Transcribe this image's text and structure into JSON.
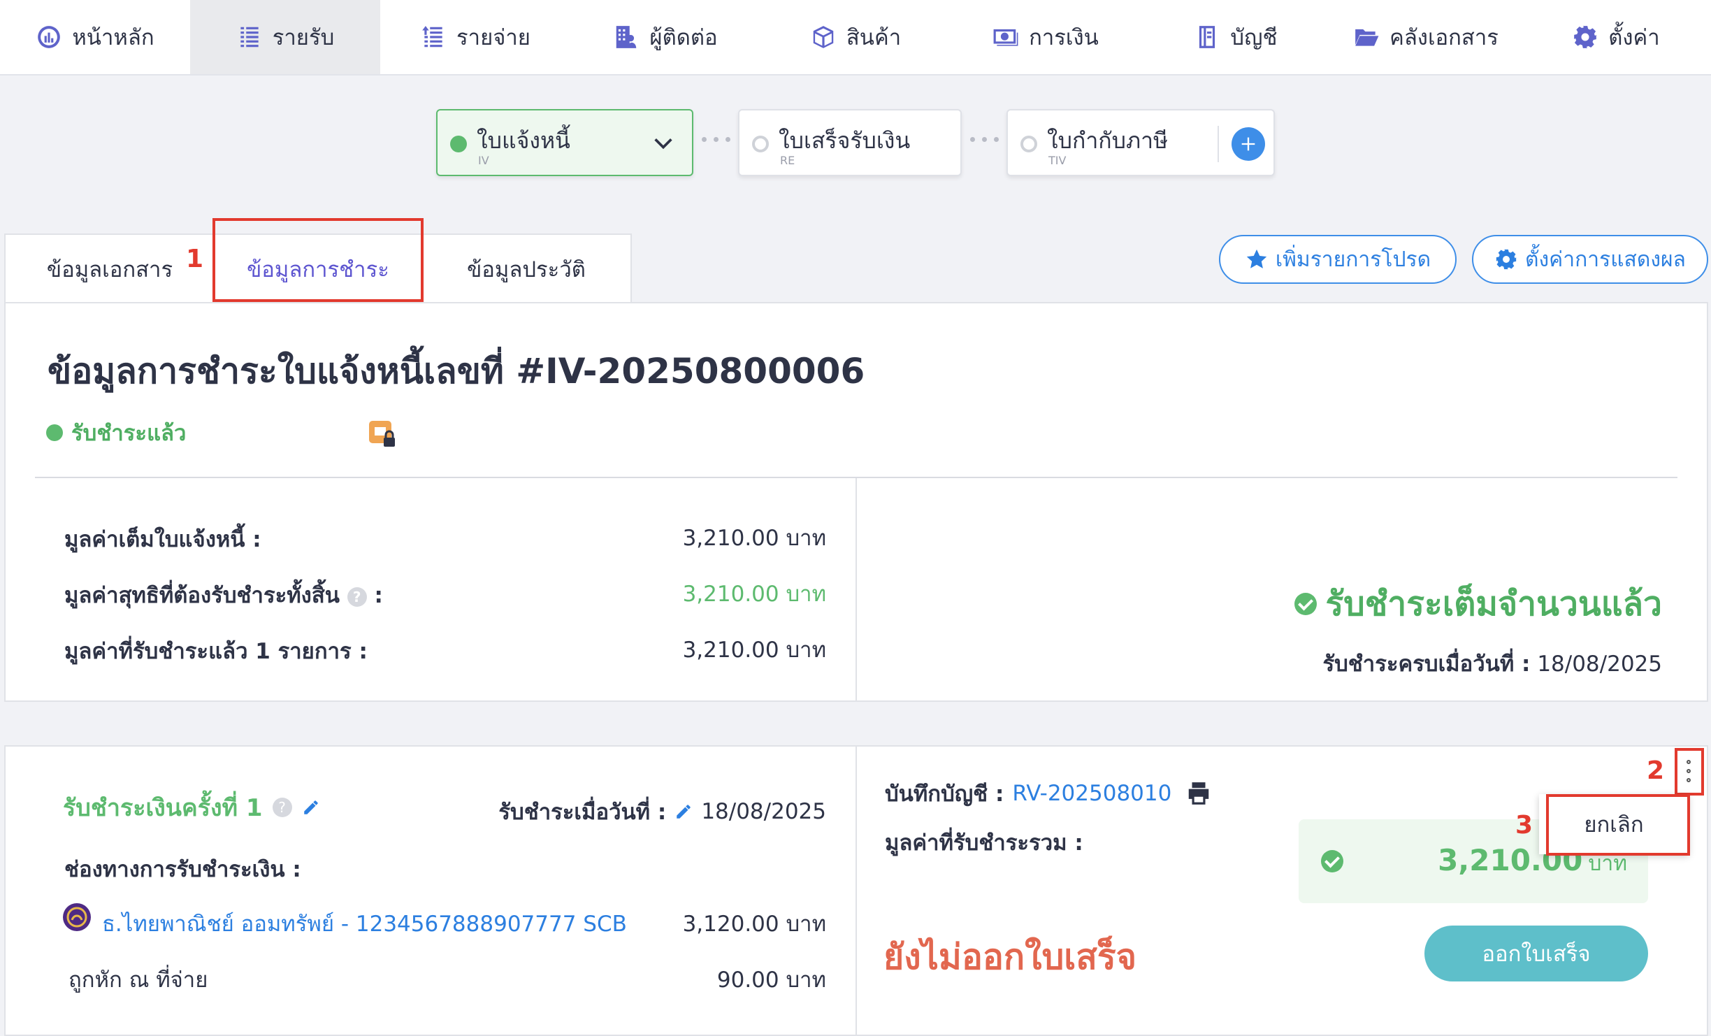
{
  "nav": {
    "items": [
      {
        "label": "หน้าหลัก",
        "icon": "dashboard-icon"
      },
      {
        "label": "รายรับ",
        "icon": "income-icon",
        "active": true
      },
      {
        "label": "รายจ่าย",
        "icon": "expense-icon"
      },
      {
        "label": "ผู้ติดต่อ",
        "icon": "contacts-icon"
      },
      {
        "label": "สินค้า",
        "icon": "box-icon"
      },
      {
        "label": "การเงิน",
        "icon": "money-icon"
      },
      {
        "label": "บัญชี",
        "icon": "ledger-icon"
      },
      {
        "label": "คลังเอกสาร",
        "icon": "folder-icon"
      },
      {
        "label": "ตั้งค่า",
        "icon": "gear-icon"
      }
    ]
  },
  "stepper": {
    "invoice": {
      "label": "ใบแจ้งหนี้",
      "code": "IV"
    },
    "receipt": {
      "label": "ใบเสร็จรับเงิน",
      "code": "RE"
    },
    "tax_invoice": {
      "label": "ใบกำกับภาษี",
      "code": "TIV"
    }
  },
  "tabs": {
    "doc_info": "ข้อมูลเอกสาร",
    "payment_info": "ข้อมูลการชำระ",
    "history": "ข้อมูลประวัติ"
  },
  "annotations": {
    "n1": "1",
    "n2": "2",
    "n3": "3"
  },
  "actions": {
    "favorite": "เพิ่มรายการโปรด",
    "display_settings": "ตั้งค่าการแสดงผล"
  },
  "summary": {
    "title": "ข้อมูลการชำระใบแจ้งหนี้เลขที่ #IV-20250800006",
    "status": "รับชำระแล้ว",
    "full_value_label": "มูลค่าเต็มใบแจ้งหนี้ :",
    "full_value": "3,210.00 บาท",
    "net_label": "มูลค่าสุทธิที่ต้องรับชำระทั้งสิ้น",
    "net_suffix": ":",
    "net_value": "3,210.00 บาท",
    "received_label": "มูลค่าที่รับชำระแล้ว 1 รายการ :",
    "received_value": "3,210.00 บาท",
    "full_paid": "รับชำระเต็มจำนวนแล้ว",
    "completed_label": "รับชำระครบเมื่อวันที่ :",
    "completed_date": "18/08/2025"
  },
  "payment": {
    "title": "รับชำระเงินครั้งที่ 1",
    "date_label": "รับชำระเมื่อวันที่ :",
    "date": "18/08/2025",
    "channel_label": "ช่องทางการรับชำระเงิน :",
    "bank": "ธ.ไทยพาณิชย์ ออมทรัพย์ - 1234567888907777 SCB",
    "bank_amount": "3,120.00 บาท",
    "withholding_label": "ถูกหัก ณ ที่จ่าย",
    "withholding_amount": "90.00 บาท",
    "journal_label": "บันทึกบัญชี :",
    "journal_no": "RV-202508010",
    "total_label": "มูลค่าที่รับชำระรวม :",
    "total_amount": "3,210.00",
    "currency": "บาท",
    "not_issued": "ยังไม่ออกใบเสร็จ",
    "issue_button": "ออกใบเสร็จ",
    "cancel": "ยกเลิก"
  },
  "colors": {
    "accent": "#5d55d0",
    "green": "#5dba6f",
    "blue": "#2c7fe0",
    "annotation": "#e23a2e",
    "warning": "#e2674f"
  }
}
